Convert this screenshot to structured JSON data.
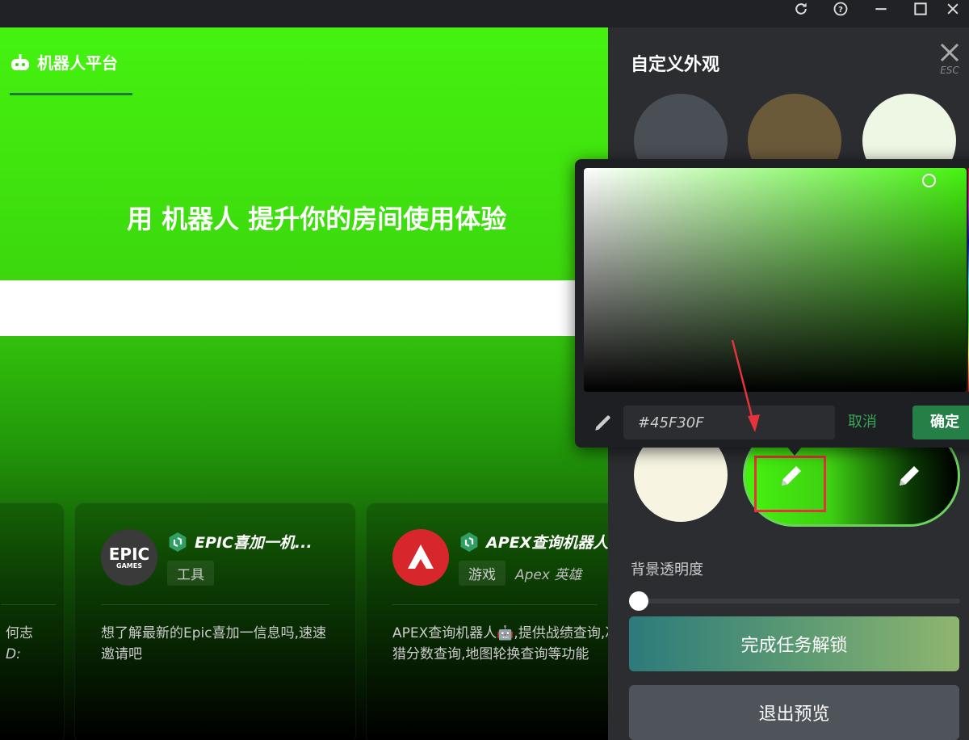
{
  "titlebar": {
    "icons": [
      "refresh-icon",
      "help-icon",
      "minimize-icon",
      "maximize-icon",
      "close-icon"
    ]
  },
  "nav": {
    "title": "机器人平台"
  },
  "hero": {
    "title": "用 机器人 提升你的房间使用体验"
  },
  "cards": [
    {
      "desc_line1": "何志",
      "desc_line2": "D:"
    },
    {
      "logo_line1": "EPIC",
      "logo_line2": "GAMES",
      "name": "EPIC喜加一机...",
      "tag": "工具",
      "desc": "想了解最新的Epic喜加一信息吗,速速邀请吧"
    },
    {
      "name": "APEX查询机器人",
      "tag": "游戏",
      "tag_secondary": "Apex 英雄",
      "desc": "APEX查询机器人🤖,提供战绩查询,冲猎分数查询,地图轮换查询等功能"
    }
  ],
  "panel": {
    "title": "自定义外观",
    "close_hint": "ESC",
    "opacity_label": "背景透明度",
    "opacity_value": 0,
    "unlock_label": "完成任务解锁",
    "exit_label": "退出预览",
    "swatch_colors": [
      "#4a4f56",
      "#6b5a3a",
      "#eef7e4",
      "#f7f5e2"
    ]
  },
  "picker": {
    "hex_value": "#45F30F",
    "cancel_label": "取消",
    "confirm_label": "确定"
  },
  "colors": {
    "accent": "#45F30F",
    "confirm": "#248046",
    "highlight": "#E5333B"
  }
}
